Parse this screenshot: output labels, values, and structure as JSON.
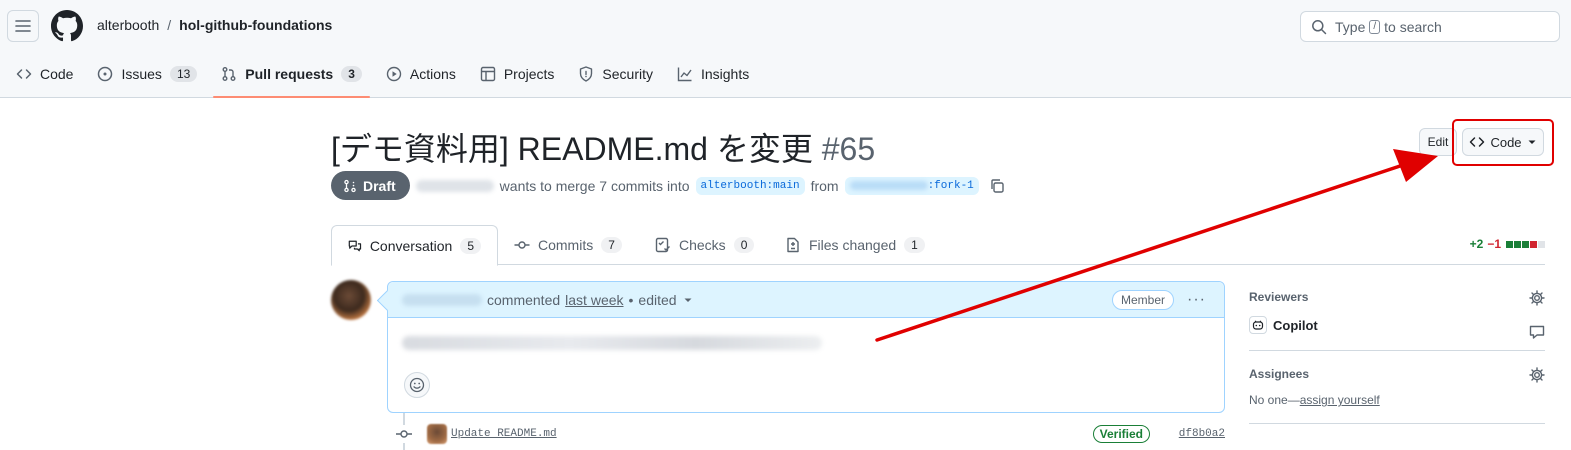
{
  "header": {
    "owner": "alterbooth",
    "separator": "/",
    "repo": "hol-github-foundations",
    "search_prefix": "Type",
    "search_key": "/",
    "search_suffix": "to search"
  },
  "reponav": [
    {
      "label": "Code",
      "icon": "code-icon"
    },
    {
      "label": "Issues",
      "icon": "issue-opened-icon",
      "count": "13"
    },
    {
      "label": "Pull requests",
      "icon": "git-pull-request-icon",
      "count": "3",
      "selected": true
    },
    {
      "label": "Actions",
      "icon": "play-icon"
    },
    {
      "label": "Projects",
      "icon": "table-icon"
    },
    {
      "label": "Security",
      "icon": "shield-icon"
    },
    {
      "label": "Insights",
      "icon": "graph-icon"
    }
  ],
  "pr": {
    "title": "[デモ資料用] README.md を変更",
    "number": "#65",
    "state": "Draft",
    "merge_text": "wants to merge 7 commits into",
    "base_branch": "alterbooth:main",
    "from_text": "from",
    "head_branch_suffix": ":fork-1",
    "edit_label": "Edit",
    "code_label": "Code"
  },
  "tabs": [
    {
      "label": "Conversation",
      "count": "5",
      "icon": "comment-discussion-icon"
    },
    {
      "label": "Commits",
      "count": "7",
      "icon": "git-commit-icon"
    },
    {
      "label": "Checks",
      "count": "0",
      "icon": "checklist-icon"
    },
    {
      "label": "Files changed",
      "count": "1",
      "icon": "file-diff-icon"
    }
  ],
  "diffstat": {
    "additions": "+2",
    "deletions": "−1"
  },
  "comment": {
    "action": "commented",
    "time": "last week",
    "dot": "•",
    "edited": "edited",
    "role": "Member",
    "more": "···"
  },
  "commit": {
    "message": "Update README.md",
    "badge": "Verified",
    "sha": "df8b0a2"
  },
  "sidebar": {
    "reviewers_heading": "Reviewers",
    "reviewer_name": "Copilot",
    "assignees_heading": "Assignees",
    "assignees_none": "No one—",
    "assign_link": "assign yourself"
  },
  "colors": {
    "accent_underline": "#fd8c73",
    "annotation_red": "#e00000",
    "link_blue": "#0969da",
    "comment_header_bg": "#ddf4ff"
  }
}
